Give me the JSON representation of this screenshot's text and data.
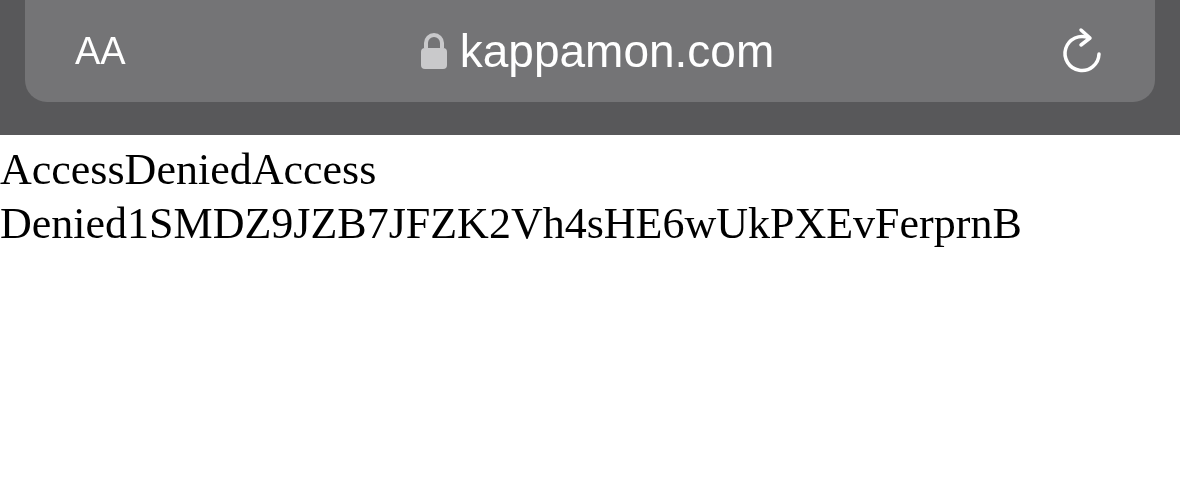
{
  "address_bar": {
    "text_size_button": "AA",
    "url": "kappamon.com",
    "secure": true
  },
  "page": {
    "text": "AccessDeniedAccess Denied1SMDZ9JZB7JFZK2Vh4sHE6wUkPXEvFerprnB"
  }
}
